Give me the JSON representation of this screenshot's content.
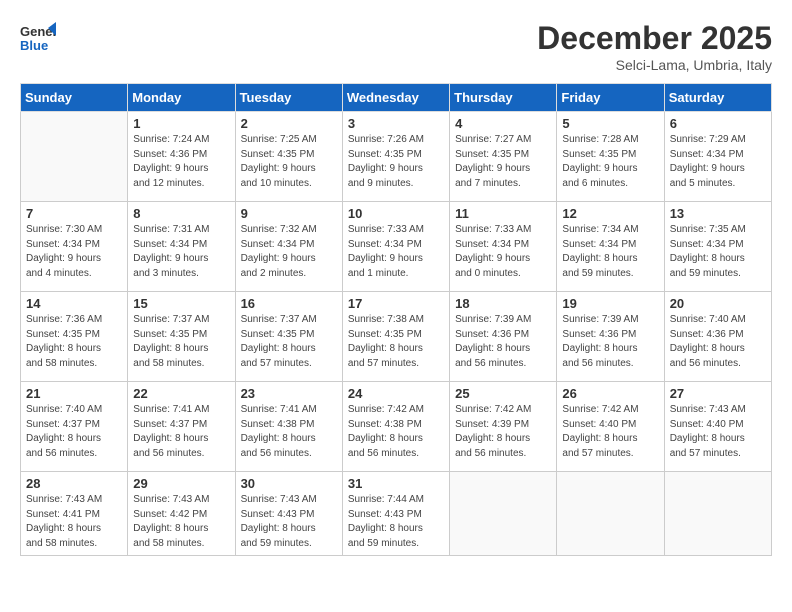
{
  "header": {
    "logo_line1": "General",
    "logo_line2": "Blue",
    "month": "December 2025",
    "location": "Selci-Lama, Umbria, Italy"
  },
  "days_of_week": [
    "Sunday",
    "Monday",
    "Tuesday",
    "Wednesday",
    "Thursday",
    "Friday",
    "Saturday"
  ],
  "weeks": [
    [
      {
        "day": "",
        "info": ""
      },
      {
        "day": "1",
        "info": "Sunrise: 7:24 AM\nSunset: 4:36 PM\nDaylight: 9 hours\nand 12 minutes."
      },
      {
        "day": "2",
        "info": "Sunrise: 7:25 AM\nSunset: 4:35 PM\nDaylight: 9 hours\nand 10 minutes."
      },
      {
        "day": "3",
        "info": "Sunrise: 7:26 AM\nSunset: 4:35 PM\nDaylight: 9 hours\nand 9 minutes."
      },
      {
        "day": "4",
        "info": "Sunrise: 7:27 AM\nSunset: 4:35 PM\nDaylight: 9 hours\nand 7 minutes."
      },
      {
        "day": "5",
        "info": "Sunrise: 7:28 AM\nSunset: 4:35 PM\nDaylight: 9 hours\nand 6 minutes."
      },
      {
        "day": "6",
        "info": "Sunrise: 7:29 AM\nSunset: 4:34 PM\nDaylight: 9 hours\nand 5 minutes."
      }
    ],
    [
      {
        "day": "7",
        "info": "Sunrise: 7:30 AM\nSunset: 4:34 PM\nDaylight: 9 hours\nand 4 minutes."
      },
      {
        "day": "8",
        "info": "Sunrise: 7:31 AM\nSunset: 4:34 PM\nDaylight: 9 hours\nand 3 minutes."
      },
      {
        "day": "9",
        "info": "Sunrise: 7:32 AM\nSunset: 4:34 PM\nDaylight: 9 hours\nand 2 minutes."
      },
      {
        "day": "10",
        "info": "Sunrise: 7:33 AM\nSunset: 4:34 PM\nDaylight: 9 hours\nand 1 minute."
      },
      {
        "day": "11",
        "info": "Sunrise: 7:33 AM\nSunset: 4:34 PM\nDaylight: 9 hours\nand 0 minutes."
      },
      {
        "day": "12",
        "info": "Sunrise: 7:34 AM\nSunset: 4:34 PM\nDaylight: 8 hours\nand 59 minutes."
      },
      {
        "day": "13",
        "info": "Sunrise: 7:35 AM\nSunset: 4:34 PM\nDaylight: 8 hours\nand 59 minutes."
      }
    ],
    [
      {
        "day": "14",
        "info": "Sunrise: 7:36 AM\nSunset: 4:35 PM\nDaylight: 8 hours\nand 58 minutes."
      },
      {
        "day": "15",
        "info": "Sunrise: 7:37 AM\nSunset: 4:35 PM\nDaylight: 8 hours\nand 58 minutes."
      },
      {
        "day": "16",
        "info": "Sunrise: 7:37 AM\nSunset: 4:35 PM\nDaylight: 8 hours\nand 57 minutes."
      },
      {
        "day": "17",
        "info": "Sunrise: 7:38 AM\nSunset: 4:35 PM\nDaylight: 8 hours\nand 57 minutes."
      },
      {
        "day": "18",
        "info": "Sunrise: 7:39 AM\nSunset: 4:36 PM\nDaylight: 8 hours\nand 56 minutes."
      },
      {
        "day": "19",
        "info": "Sunrise: 7:39 AM\nSunset: 4:36 PM\nDaylight: 8 hours\nand 56 minutes."
      },
      {
        "day": "20",
        "info": "Sunrise: 7:40 AM\nSunset: 4:36 PM\nDaylight: 8 hours\nand 56 minutes."
      }
    ],
    [
      {
        "day": "21",
        "info": "Sunrise: 7:40 AM\nSunset: 4:37 PM\nDaylight: 8 hours\nand 56 minutes."
      },
      {
        "day": "22",
        "info": "Sunrise: 7:41 AM\nSunset: 4:37 PM\nDaylight: 8 hours\nand 56 minutes."
      },
      {
        "day": "23",
        "info": "Sunrise: 7:41 AM\nSunset: 4:38 PM\nDaylight: 8 hours\nand 56 minutes."
      },
      {
        "day": "24",
        "info": "Sunrise: 7:42 AM\nSunset: 4:38 PM\nDaylight: 8 hours\nand 56 minutes."
      },
      {
        "day": "25",
        "info": "Sunrise: 7:42 AM\nSunset: 4:39 PM\nDaylight: 8 hours\nand 56 minutes."
      },
      {
        "day": "26",
        "info": "Sunrise: 7:42 AM\nSunset: 4:40 PM\nDaylight: 8 hours\nand 57 minutes."
      },
      {
        "day": "27",
        "info": "Sunrise: 7:43 AM\nSunset: 4:40 PM\nDaylight: 8 hours\nand 57 minutes."
      }
    ],
    [
      {
        "day": "28",
        "info": "Sunrise: 7:43 AM\nSunset: 4:41 PM\nDaylight: 8 hours\nand 58 minutes."
      },
      {
        "day": "29",
        "info": "Sunrise: 7:43 AM\nSunset: 4:42 PM\nDaylight: 8 hours\nand 58 minutes."
      },
      {
        "day": "30",
        "info": "Sunrise: 7:43 AM\nSunset: 4:43 PM\nDaylight: 8 hours\nand 59 minutes."
      },
      {
        "day": "31",
        "info": "Sunrise: 7:44 AM\nSunset: 4:43 PM\nDaylight: 8 hours\nand 59 minutes."
      },
      {
        "day": "",
        "info": ""
      },
      {
        "day": "",
        "info": ""
      },
      {
        "day": "",
        "info": ""
      }
    ]
  ]
}
